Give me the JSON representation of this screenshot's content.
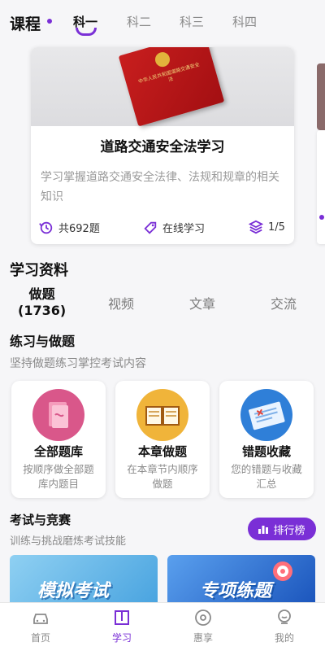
{
  "header": {
    "title": "课程",
    "tabs": [
      {
        "label": "科一",
        "active": true
      },
      {
        "label": "科二",
        "active": false
      },
      {
        "label": "科三",
        "active": false
      },
      {
        "label": "科四",
        "active": false
      }
    ]
  },
  "course_card": {
    "book_title": "中华人民共和国道路交通安全法",
    "title": "道路交通安全法学习",
    "description": "学习掌握道路交通安全法律、法规和规章的相关知识",
    "question_count": "共692题",
    "mode": "在线学习",
    "page": "1/5"
  },
  "materials": {
    "title": "学习资料",
    "tabs": [
      {
        "label": "做题",
        "count": "(1736)",
        "active": true
      },
      {
        "label": "视频",
        "active": false
      },
      {
        "label": "文章",
        "active": false
      },
      {
        "label": "交流",
        "active": false
      }
    ]
  },
  "practice": {
    "title": "练习与做题",
    "description": "坚持做题练习掌控考试内容",
    "cards": [
      {
        "icon": "book-stack-icon",
        "title": "全部题库",
        "description": "按顺序做全部题库内题目",
        "color": "#d9578a"
      },
      {
        "icon": "open-book-icon",
        "title": "本章做题",
        "description": "在本章节内顺序做题",
        "color": "#f0b43a"
      },
      {
        "icon": "error-sheet-icon",
        "title": "错题收藏",
        "description": "您的错题与收藏汇总",
        "color": "#2f7fd8"
      }
    ]
  },
  "exam": {
    "title": "考试与竞赛",
    "description": "训练与挑战磨炼考试技能",
    "rank_button": "排行榜",
    "banners": [
      {
        "label": "模拟考试",
        "color": "#5fb3e6"
      },
      {
        "label": "专项练题",
        "color": "#2a6fd0"
      }
    ]
  },
  "nav": {
    "items": [
      {
        "label": "首页",
        "icon": "car-icon",
        "active": false
      },
      {
        "label": "学习",
        "icon": "book-icon",
        "active": true
      },
      {
        "label": "惠享",
        "icon": "discount-icon",
        "active": false
      },
      {
        "label": "我的",
        "icon": "profile-icon",
        "active": false
      }
    ]
  },
  "colors": {
    "accent": "#7a2fd6"
  }
}
